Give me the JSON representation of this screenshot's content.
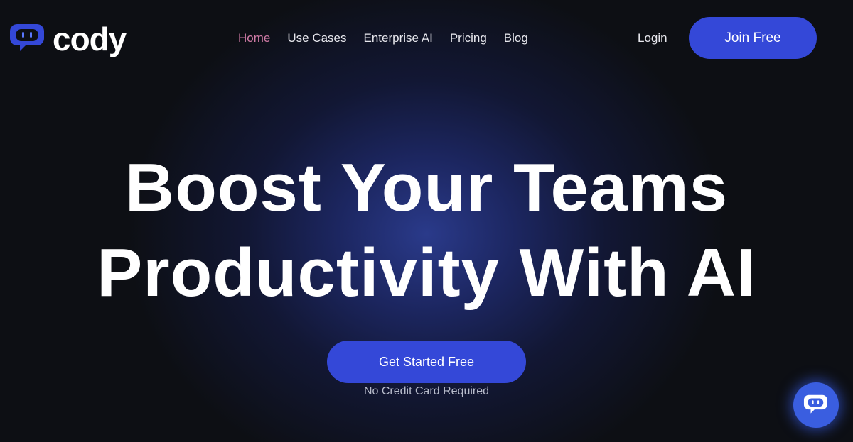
{
  "brand": {
    "name": "cody",
    "logo_icon": "chat-bubble-robot-icon",
    "accent": "#3448d8",
    "active_nav_color": "#d07ba6"
  },
  "nav": {
    "items": [
      {
        "label": "Home",
        "active": true
      },
      {
        "label": "Use Cases",
        "active": false
      },
      {
        "label": "Enterprise AI",
        "active": false
      },
      {
        "label": "Pricing",
        "active": false
      },
      {
        "label": "Blog",
        "active": false
      }
    ],
    "login_label": "Login",
    "join_label": "Join Free"
  },
  "hero": {
    "headline_line1": "Boost Your Teams",
    "headline_line2": "Productivity With AI",
    "cta_label": "Get Started Free",
    "cta_note": "No Credit Card Required"
  },
  "chat_widget": {
    "icon": "chat-bubble-robot-icon"
  }
}
